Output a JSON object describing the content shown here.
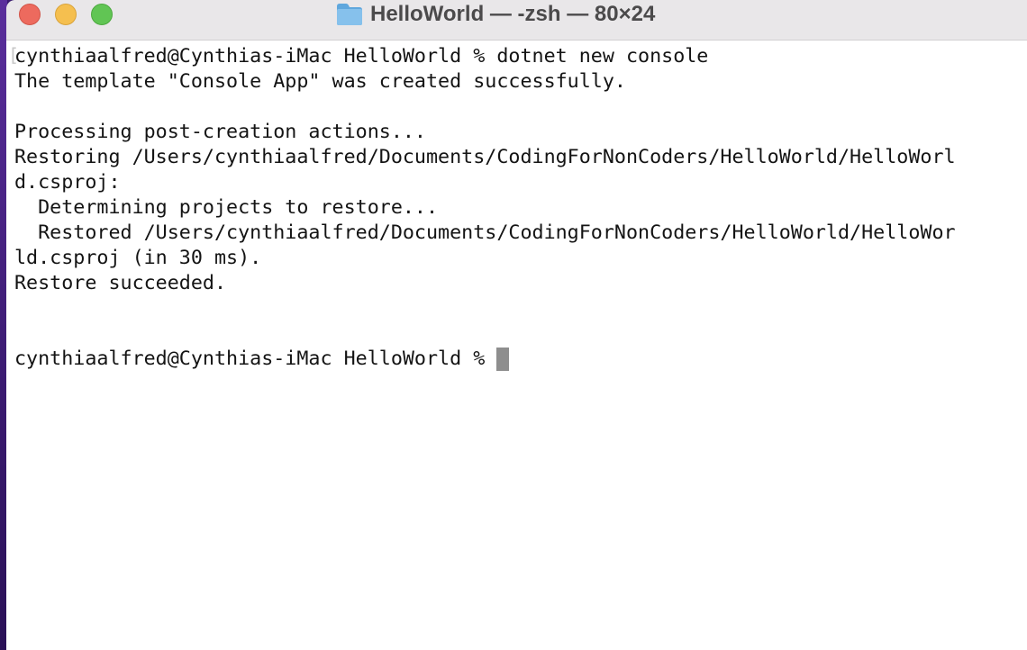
{
  "window": {
    "title": "HelloWorld — -zsh — 80×24",
    "colors": {
      "close": "#ed6a5e",
      "minimize": "#f5bf4f",
      "zoom": "#61c554",
      "background": "#ffffff",
      "text": "#141414"
    }
  },
  "terminal": {
    "lines": [
      "cynthiaalfred@Cynthias-iMac HelloWorld % dotnet new console",
      "The template \"Console App\" was created successfully.",
      "",
      "Processing post-creation actions...",
      "Restoring /Users/cynthiaalfred/Documents/CodingForNonCoders/HelloWorld/HelloWorl",
      "d.csproj:",
      "  Determining projects to restore...",
      "  Restored /Users/cynthiaalfred/Documents/CodingForNonCoders/HelloWorld/HelloWor",
      "ld.csproj (in 30 ms).",
      "Restore succeeded."
    ],
    "prompt": "cynthiaalfred@Cynthias-iMac HelloWorld % "
  }
}
